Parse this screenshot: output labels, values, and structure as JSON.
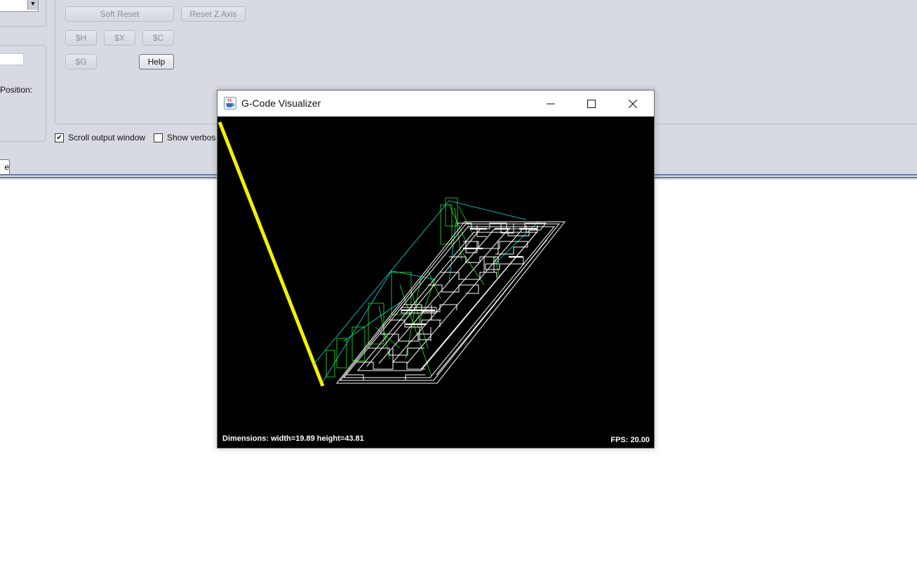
{
  "main_window": {
    "buttons": {
      "soft_reset": "Soft Reset",
      "reset_z_axis": "Reset Z Axis",
      "home": "$H",
      "kill_alarm": "$X",
      "check_mode": "$C",
      "parser_state": "$G",
      "help": "Help"
    },
    "position_label": "Position:",
    "checkboxes": {
      "scroll_output": {
        "label": "Scroll output window",
        "checked": true
      },
      "show_verbose": {
        "label": "Show verbos",
        "checked": false
      }
    },
    "tab_partial_label": "e"
  },
  "visualizer": {
    "title": "G-Code Visualizer",
    "dimensions_text": "Dimensions: width=19.89 height=43.81",
    "fps_text": "FPS: 20.00",
    "colors": {
      "background": "#000000",
      "cut_path": "#ffffff",
      "rapid_move": "#00e0e0",
      "plunge": "#22ee22",
      "tool_axis": "#f2f200"
    },
    "icons": {
      "app": "java-coffee-cup-icon",
      "minimize": "minimize-icon",
      "maximize": "maximize-icon",
      "close": "close-icon"
    }
  }
}
